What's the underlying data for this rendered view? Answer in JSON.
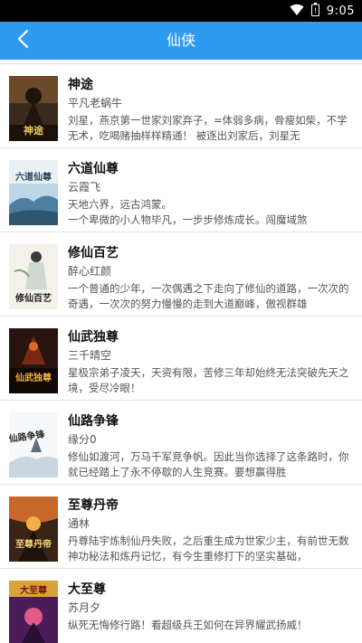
{
  "status_bar": {
    "time": "9:05",
    "icons": [
      "wifi-icon",
      "battery-icon"
    ]
  },
  "header": {
    "title": "仙侠",
    "back_icon": "chevron-left-icon",
    "color": "#2f9bf0"
  },
  "books": [
    {
      "title": "神途",
      "author": "平凡老蜗牛",
      "description": "刘星，燕京第一世家刘家弃子，=体弱多病，骨瘦如柴，不学无术，吃喝赌抽样样精通！ 被逐出刘家后，刘星无",
      "cover_title": "神途"
    },
    {
      "title": "六道仙尊",
      "author": "云霞飞",
      "description": "天地六界，远古鸿蒙。\n一个卑微的小人物毕凡，一步步修炼成长。闯魔域煞",
      "cover_title": "六道仙尊"
    },
    {
      "title": "修仙百艺",
      "author": "醉心红颜",
      "description": "一个普通的少年，一次偶遇之下走向了修仙的道路，一次次的奇遇，一次次的努力慢慢的走到大道巅峰，傲视群雄",
      "cover_title": "修仙百艺"
    },
    {
      "title": "仙武独尊",
      "author": "三千晴空",
      "description": "星极宗弟子凌天，天资有限，苦修三年却始终无法突破先天之境，受尽冷眼！",
      "cover_title": "仙武独尊"
    },
    {
      "title": "仙路争锋",
      "author": "缘分0",
      "description": "修仙如渡河，万马千军竞争帆。因此当你选择了这条路时，你就已经踏上了永不停歇的人生竞赛。要想赢得胜",
      "cover_title": "仙路争锋"
    },
    {
      "title": "至尊丹帝",
      "author": "通林",
      "description": "丹尊陆宇炼制仙丹失败，之后重生成为世家少主，有前世无数神功秘法和炼丹记忆，有今生重修打下的坚实基础，",
      "cover_title": "至尊丹帝"
    },
    {
      "title": "大至尊",
      "author": "苏月夕",
      "description": "纵死无悔修行路！看超级兵王如何在异界耀武扬威！",
      "cover_title": "大至尊"
    }
  ]
}
